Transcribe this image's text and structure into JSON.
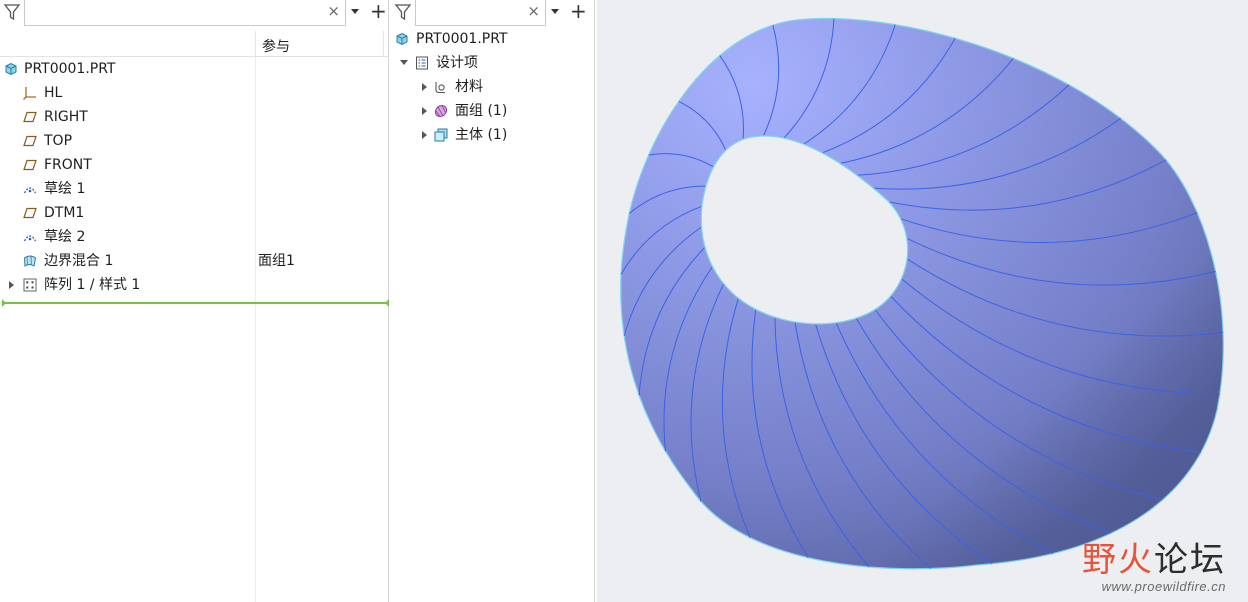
{
  "model_tree": {
    "search": {
      "value": "",
      "placeholder": ""
    },
    "column_header": "参与",
    "items": [
      {
        "label": "PRT0001.PRT",
        "icon": "part-icon",
        "ref": ""
      },
      {
        "label": "HL",
        "icon": "csys-icon",
        "ref": ""
      },
      {
        "label": "RIGHT",
        "icon": "datum-plane-icon",
        "ref": ""
      },
      {
        "label": "TOP",
        "icon": "datum-plane-icon",
        "ref": ""
      },
      {
        "label": "FRONT",
        "icon": "datum-plane-icon",
        "ref": ""
      },
      {
        "label": "草绘 1",
        "icon": "sketch-icon",
        "ref": ""
      },
      {
        "label": "DTM1",
        "icon": "datum-plane-icon",
        "ref": ""
      },
      {
        "label": "草绘 2",
        "icon": "sketch-icon",
        "ref": ""
      },
      {
        "label": "边界混合 1",
        "icon": "boundary-blend-icon",
        "ref": "面组1"
      },
      {
        "label": "阵列 1 / 样式 1",
        "icon": "pattern-icon",
        "ref": ""
      }
    ]
  },
  "detail_tree": {
    "search": {
      "value": "",
      "placeholder": ""
    },
    "root": "PRT0001.PRT",
    "design_items": "设计项",
    "children": [
      {
        "label": "材料",
        "icon": "material-icon"
      },
      {
        "label": "面组 (1)",
        "icon": "quilt-icon"
      },
      {
        "label": "主体 (1)",
        "icon": "body-icon"
      }
    ]
  },
  "watermark": {
    "part1": "野火",
    "part2": "论坛",
    "url": "www.proewildfire.cn"
  },
  "colors": {
    "surface": "#8a96e0",
    "edge": "#3a62e8",
    "background": "#eceef1",
    "insert_line": "#77c04d",
    "accent_red": "#e8533a"
  }
}
